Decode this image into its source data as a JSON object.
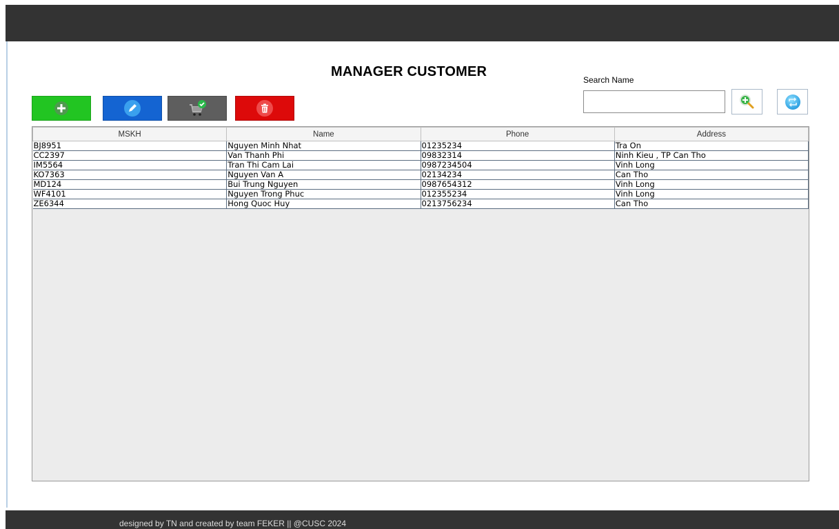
{
  "title": "MANAGER CUSTOMER",
  "search": {
    "label": "Search Name",
    "value": "",
    "placeholder": ""
  },
  "toolbar": [
    {
      "name": "add-button",
      "icon": "plus-icon",
      "color": "#22c522"
    },
    {
      "name": "edit-button",
      "icon": "pencil-icon",
      "color": "#1464d2"
    },
    {
      "name": "cart-button",
      "icon": "cart-check-icon",
      "color": "#5e5e5e"
    },
    {
      "name": "delete-button",
      "icon": "trash-icon",
      "color": "#dd0a0a"
    }
  ],
  "search_buttons": [
    {
      "name": "search-button",
      "icon": "search-add-icon"
    },
    {
      "name": "refresh-button",
      "icon": "refresh-icon"
    }
  ],
  "table": {
    "columns": [
      "MSKH",
      "Name",
      "Phone",
      "Address"
    ],
    "rows": [
      [
        "BJ8951",
        "Nguyen Minh Nhat",
        "01235234",
        "Tra On"
      ],
      [
        "CC2397",
        "Van Thanh Phi",
        "09832314",
        "Ninh Kieu , TP Can Tho"
      ],
      [
        "IM5564",
        "Tran Thi Cam Lai",
        "0987234504",
        "Vinh Long"
      ],
      [
        "KO7363",
        "Nguyen Van A",
        "02134234",
        "Can Tho"
      ],
      [
        "MD124",
        "Bui Trung Nguyen",
        "0987654312",
        "Vinh Long"
      ],
      [
        "WF4101",
        "Nguyen Trong Phuc",
        "012355234",
        "Vinh Long"
      ],
      [
        "ZE6344",
        "Hong Quoc Huy",
        "0213756234",
        "Can Tho"
      ]
    ]
  },
  "footer": "designed by TN and created by team FEKER || @CUSC 2024",
  "colors": {
    "header_bar": "#333333",
    "footer_bar": "#333333",
    "add": "#22c522",
    "edit": "#1464d2",
    "cart": "#5e5e5e",
    "delete": "#dd0a0a"
  }
}
